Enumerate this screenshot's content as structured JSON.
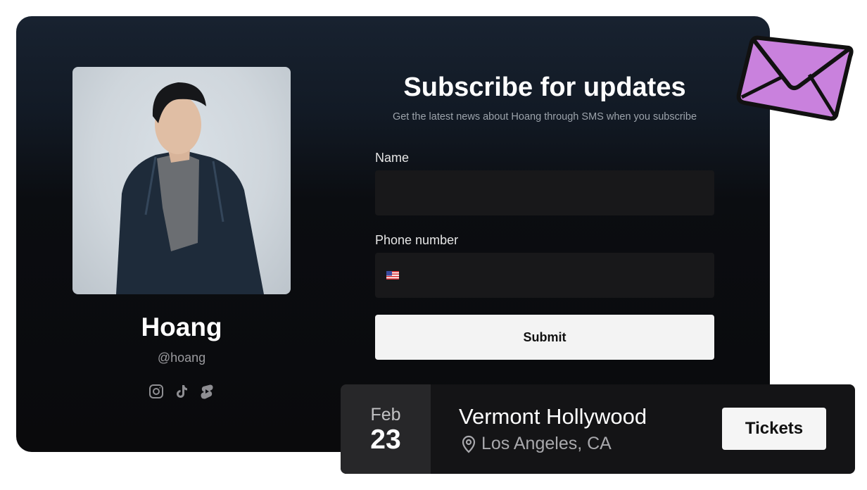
{
  "profile": {
    "name": "Hoang",
    "handle": "@hoang",
    "socials": [
      {
        "icon": "instagram-icon"
      },
      {
        "icon": "tiktok-icon"
      },
      {
        "icon": "shorts-icon"
      }
    ]
  },
  "form": {
    "title": "Subscribe for updates",
    "subtitle": "Get the latest news about Hoang through SMS when you subscribe",
    "name_label": "Name",
    "name_value": "",
    "phone_label": "Phone number",
    "phone_value": "",
    "phone_flag": "us-flag-icon",
    "submit_label": "Submit"
  },
  "event": {
    "month": "Feb",
    "day": "23",
    "venue": "Vermont Hollywood",
    "location": "Los Angeles, CA",
    "tickets_label": "Tickets"
  },
  "colors": {
    "envelope": "#c981dd",
    "card_top": "#182230",
    "card_bottom": "#0a0a0c"
  }
}
